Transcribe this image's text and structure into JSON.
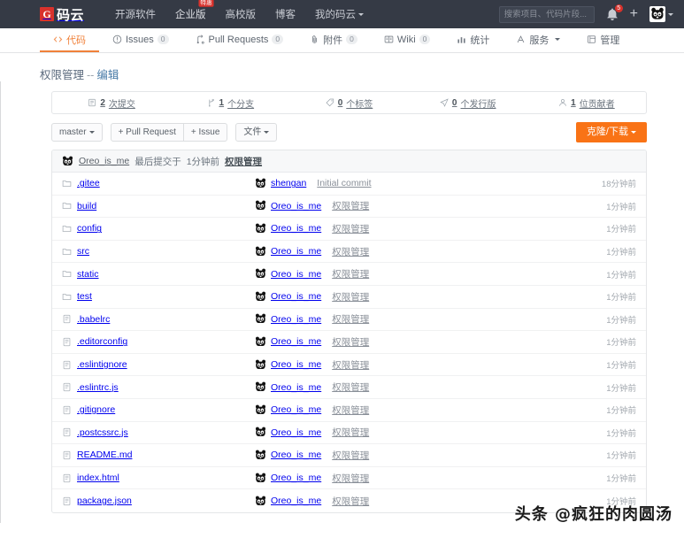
{
  "topnav": {
    "logo_mark": "G",
    "logo_text": "码云",
    "links": [
      {
        "label": "开源软件",
        "badge": ""
      },
      {
        "label": "企业版",
        "badge": "特惠"
      },
      {
        "label": "高校版",
        "badge": ""
      },
      {
        "label": "博客",
        "badge": ""
      },
      {
        "label": "我的码云",
        "badge": ""
      }
    ],
    "search_placeholder": "搜索项目、代码片段...",
    "notification_count": "5",
    "plus_label": "+",
    "avatar_name": "user-avatar"
  },
  "repotabs": [
    {
      "label": "代码",
      "count": "",
      "icon": "code-icon",
      "active": true
    },
    {
      "label": "Issues",
      "count": "0",
      "icon": "issue-icon",
      "active": false
    },
    {
      "label": "Pull Requests",
      "count": "0",
      "icon": "pull-request-icon",
      "active": false
    },
    {
      "label": "附件",
      "count": "0",
      "icon": "attachment-icon",
      "active": false
    },
    {
      "label": "Wiki",
      "count": "0",
      "icon": "wiki-icon",
      "active": false
    },
    {
      "label": "统计",
      "count": "",
      "icon": "stats-icon",
      "active": false
    },
    {
      "label": "服务",
      "count": "",
      "icon": "service-icon",
      "active": false,
      "caret": true
    },
    {
      "label": "管理",
      "count": "",
      "icon": "manage-icon",
      "active": false
    }
  ],
  "page": {
    "title_main": "权限管理",
    "title_sep": "--",
    "title_edit": "编辑"
  },
  "stats": [
    {
      "icon": "commit-icon",
      "value": "2",
      "unit": "次提交"
    },
    {
      "icon": "branch-icon",
      "value": "1",
      "unit": "个分支"
    },
    {
      "icon": "tag-icon",
      "value": "0",
      "unit": "个标签"
    },
    {
      "icon": "release-icon",
      "value": "0",
      "unit": "个发行版"
    },
    {
      "icon": "contributor-icon",
      "value": "1",
      "unit": "位贡献者"
    }
  ],
  "toolbar": {
    "branch_label": "master",
    "pull_request_label": "+ Pull Request",
    "issue_label": "+ Issue",
    "file_label": "文件",
    "clone_label": "克隆/下载"
  },
  "commitbar": {
    "author": "Oreo_is_me",
    "text": "最后提交于",
    "time": "1分钟前",
    "message": "权限管理"
  },
  "files": [
    {
      "name": ".gitee",
      "type": "folder",
      "author": "shengan",
      "message": "Initial commit",
      "time": "18分钟前"
    },
    {
      "name": "build",
      "type": "folder",
      "author": "Oreo_is_me",
      "message": "权限管理",
      "time": "1分钟前"
    },
    {
      "name": "config",
      "type": "folder",
      "author": "Oreo_is_me",
      "message": "权限管理",
      "time": "1分钟前"
    },
    {
      "name": "src",
      "type": "folder",
      "author": "Oreo_is_me",
      "message": "权限管理",
      "time": "1分钟前"
    },
    {
      "name": "static",
      "type": "folder",
      "author": "Oreo_is_me",
      "message": "权限管理",
      "time": "1分钟前"
    },
    {
      "name": "test",
      "type": "folder",
      "author": "Oreo_is_me",
      "message": "权限管理",
      "time": "1分钟前"
    },
    {
      "name": ".babelrc",
      "type": "file",
      "author": "Oreo_is_me",
      "message": "权限管理",
      "time": "1分钟前"
    },
    {
      "name": ".editorconfig",
      "type": "file",
      "author": "Oreo_is_me",
      "message": "权限管理",
      "time": "1分钟前"
    },
    {
      "name": ".eslintignore",
      "type": "file",
      "author": "Oreo_is_me",
      "message": "权限管理",
      "time": "1分钟前"
    },
    {
      "name": ".eslintrc.js",
      "type": "file",
      "author": "Oreo_is_me",
      "message": "权限管理",
      "time": "1分钟前"
    },
    {
      "name": ".gitignore",
      "type": "file",
      "author": "Oreo_is_me",
      "message": "权限管理",
      "time": "1分钟前"
    },
    {
      "name": ".postcssrc.js",
      "type": "file",
      "author": "Oreo_is_me",
      "message": "权限管理",
      "time": "1分钟前"
    },
    {
      "name": "README.md",
      "type": "file",
      "author": "Oreo_is_me",
      "message": "权限管理",
      "time": "1分钟前"
    },
    {
      "name": "index.html",
      "type": "file",
      "author": "Oreo_is_me",
      "message": "权限管理",
      "time": "1分钟前"
    },
    {
      "name": "package.json",
      "type": "file",
      "author": "Oreo_is_me",
      "message": "权限管理",
      "time": "1分钟前"
    }
  ],
  "watermark": {
    "text": "头条 @疯狂的肉圆汤"
  },
  "colors": {
    "topbar_bg": "#353a45",
    "accent_orange": "#f0813a",
    "clone_orange": "#f97316",
    "brand_red": "#d9322c"
  }
}
